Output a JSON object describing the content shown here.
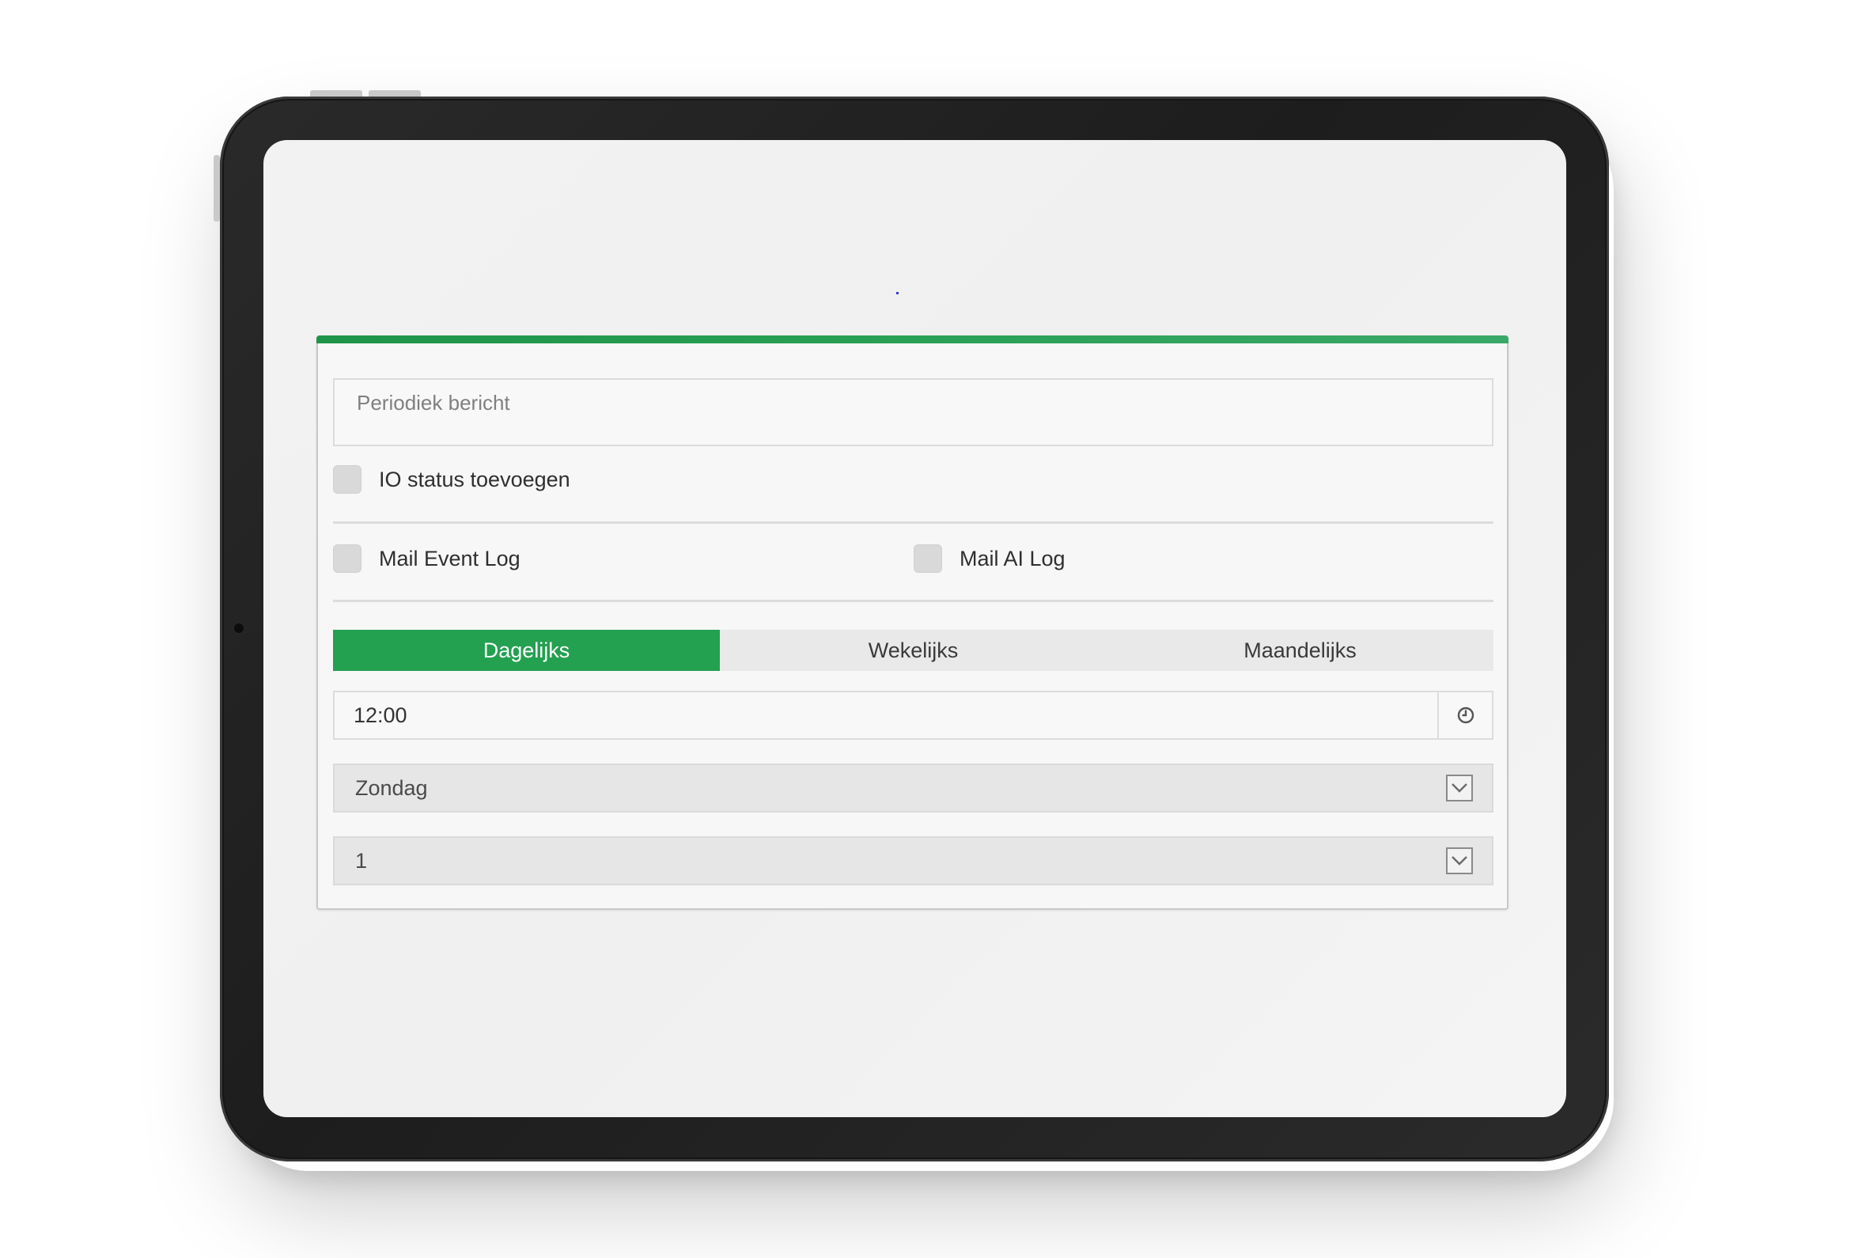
{
  "form": {
    "message_placeholder": "Periodiek bericht",
    "io_status_label": "IO status toevoegen",
    "mail_event_log_label": "Mail Event Log",
    "mail_ai_log_label": "Mail AI Log",
    "tabs": [
      {
        "label": "Dagelijks",
        "active": true
      },
      {
        "label": "Wekelijks",
        "active": false
      },
      {
        "label": "Maandelijks",
        "active": false
      }
    ],
    "time_value": "12:00",
    "day_select_value": "Zondag",
    "number_select_value": "1"
  },
  "icons": {
    "time": "clock-icon",
    "dropdown": "chevron-down-icon"
  },
  "colors": {
    "accent_green": "#23a050",
    "checkbox_gray": "#d9d9d9",
    "device_frame": "#1f1f1f"
  }
}
